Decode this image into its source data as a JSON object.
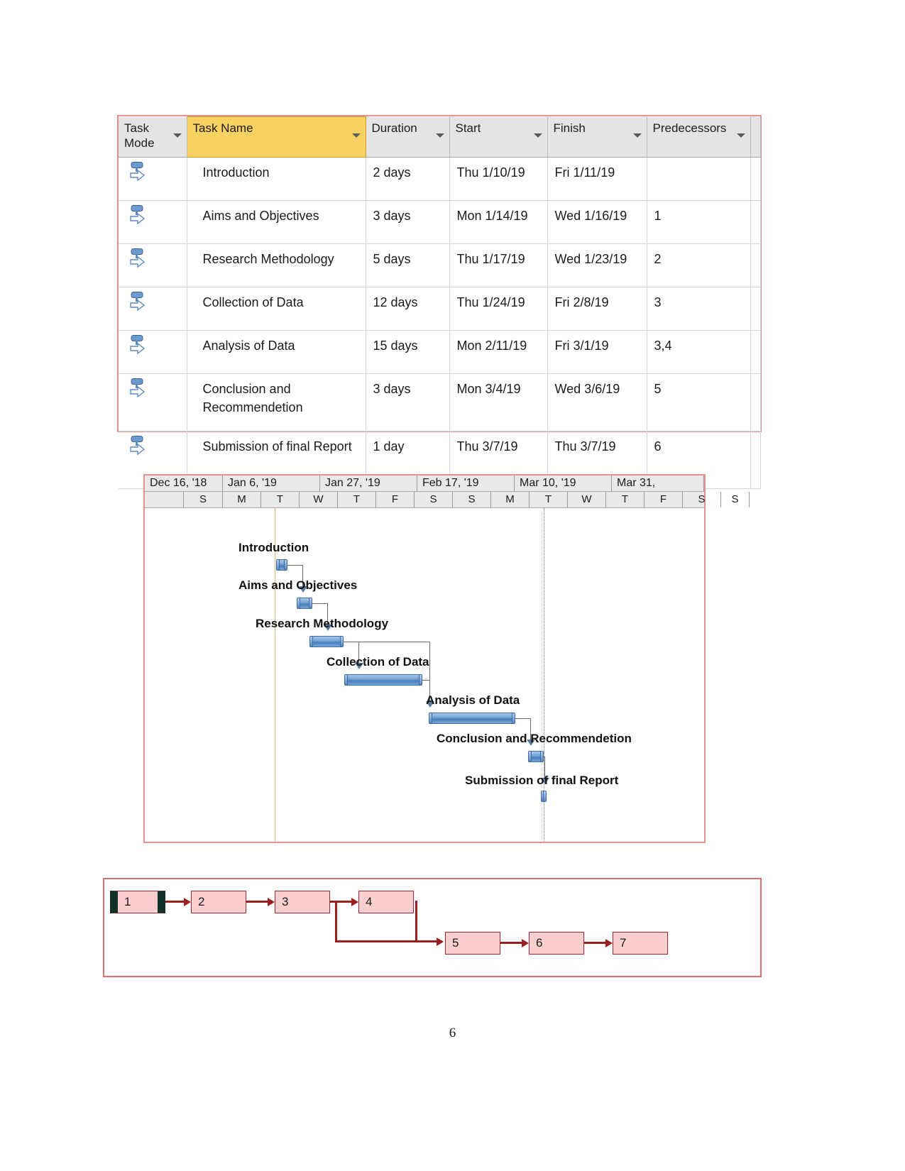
{
  "document": {
    "page_number": "6"
  },
  "task_table": {
    "columns": [
      {
        "key": "task_mode",
        "label": "Task Mode",
        "has_filter": true,
        "selected": false
      },
      {
        "key": "task_name",
        "label": "Task Name",
        "has_filter": true,
        "selected": true
      },
      {
        "key": "duration",
        "label": "Duration",
        "has_filter": true,
        "selected": false
      },
      {
        "key": "start",
        "label": "Start",
        "has_filter": true,
        "selected": false
      },
      {
        "key": "finish",
        "label": "Finish",
        "has_filter": true,
        "selected": false
      },
      {
        "key": "predecessors",
        "label": "Predecessors",
        "has_filter": true,
        "selected": false
      }
    ],
    "mode_icon": "auto-scheduled-icon",
    "rows": [
      {
        "task_name": "Introduction",
        "duration": "2 days",
        "start": "Thu 1/10/19",
        "finish": "Fri 1/11/19",
        "predecessors": ""
      },
      {
        "task_name": "Aims and Objectives",
        "duration": "3 days",
        "start": "Mon 1/14/19",
        "finish": "Wed 1/16/19",
        "predecessors": "1"
      },
      {
        "task_name": "Research Methodology",
        "duration": "5 days",
        "start": "Thu 1/17/19",
        "finish": "Wed 1/23/19",
        "predecessors": "2"
      },
      {
        "task_name": "Collection of Data",
        "duration": "12 days",
        "start": "Thu 1/24/19",
        "finish": "Fri 2/8/19",
        "predecessors": "3"
      },
      {
        "task_name": "Analysis of Data",
        "duration": "15 days",
        "start": "Mon 2/11/19",
        "finish": "Fri 3/1/19",
        "predecessors": "3,4"
      },
      {
        "task_name": "Conclusion and Recommendetion",
        "duration": "3 days",
        "start": "Mon 3/4/19",
        "finish": "Wed 3/6/19",
        "predecessors": "5"
      },
      {
        "task_name": "Submission of final Report",
        "duration": "1 day",
        "start": "Thu 3/7/19",
        "finish": "Thu 3/7/19",
        "predecessors": "6"
      }
    ]
  },
  "gantt": {
    "timescale": {
      "months": [
        "Dec 16, '18",
        "Jan 6, '19",
        "Jan 27, '19",
        "Feb 17, '19",
        "Mar 10, '19",
        "Mar 31,"
      ],
      "days": [
        "S",
        "M",
        "T",
        "W",
        "T",
        "F",
        "S",
        "S"
      ]
    },
    "bars": [
      {
        "label": "Introduction",
        "duration_days": 2
      },
      {
        "label": "Aims and Objectives",
        "duration_days": 3
      },
      {
        "label": "Research Methodology",
        "duration_days": 5
      },
      {
        "label": "Collection of Data",
        "duration_days": 12
      },
      {
        "label": "Analysis of Data",
        "duration_days": 15
      },
      {
        "label": "Conclusion and Recommendetion",
        "duration_days": 3
      },
      {
        "label": "Submission of final Report",
        "duration_days": 1
      }
    ]
  },
  "network_diagram": {
    "nodes": [
      {
        "id": "1",
        "label": "1",
        "critical": true
      },
      {
        "id": "2",
        "label": "2",
        "critical": false
      },
      {
        "id": "3",
        "label": "3",
        "critical": false
      },
      {
        "id": "4",
        "label": "4",
        "critical": false
      },
      {
        "id": "5",
        "label": "5",
        "critical": false
      },
      {
        "id": "6",
        "label": "6",
        "critical": false
      },
      {
        "id": "7",
        "label": "7",
        "critical": false
      }
    ],
    "colors": {
      "node_fill": "#fbcfcf",
      "node_border": "#9c2a2a",
      "link": "#9c1f1f",
      "critical_marker": "#11312a"
    }
  }
}
